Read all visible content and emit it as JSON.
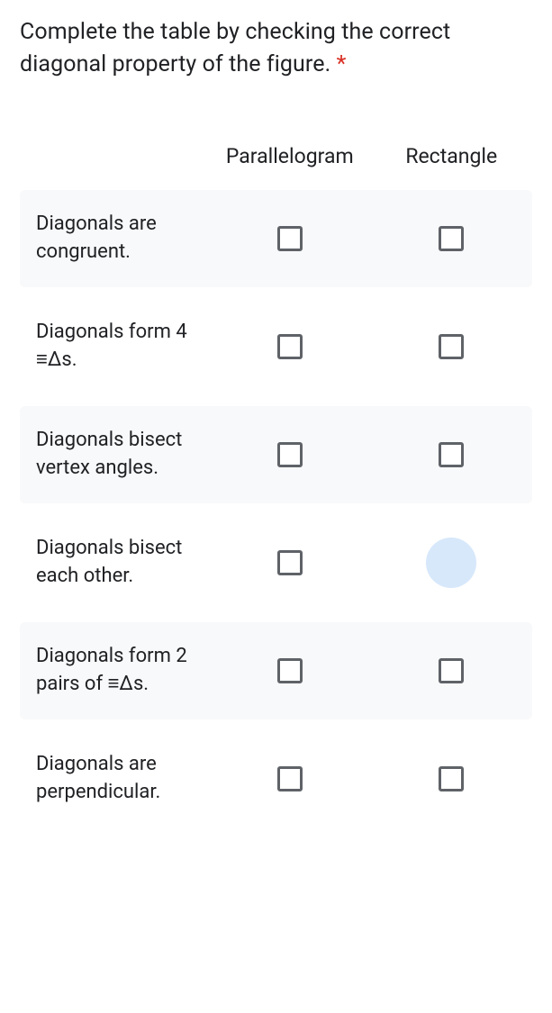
{
  "question": {
    "text": "Complete the table by checking the correct diagonal property of the figure. ",
    "required_mark": "*"
  },
  "columns": [
    "Parallelogram",
    "Rectangle"
  ],
  "rows": [
    {
      "label": "Diagonals are congruent.",
      "cells": [
        {
          "checked": false,
          "highlight": false
        },
        {
          "checked": false,
          "highlight": false
        }
      ]
    },
    {
      "label": "Diagonals form 4 ≡Δs.",
      "cells": [
        {
          "checked": false,
          "highlight": false
        },
        {
          "checked": false,
          "highlight": false
        }
      ]
    },
    {
      "label": "Diagonals bisect vertex angles.",
      "cells": [
        {
          "checked": false,
          "highlight": false
        },
        {
          "checked": false,
          "highlight": false
        }
      ]
    },
    {
      "label": "Diagonals bisect each other.",
      "cells": [
        {
          "checked": false,
          "highlight": false
        },
        {
          "checked": false,
          "highlight": true
        }
      ]
    },
    {
      "label": "Diagonals form 2 pairs of ≡Δs.",
      "cells": [
        {
          "checked": false,
          "highlight": false
        },
        {
          "checked": false,
          "highlight": false
        }
      ]
    },
    {
      "label": "Diagonals are perpendicular.",
      "cells": [
        {
          "checked": false,
          "highlight": false
        },
        {
          "checked": false,
          "highlight": false
        }
      ]
    }
  ]
}
